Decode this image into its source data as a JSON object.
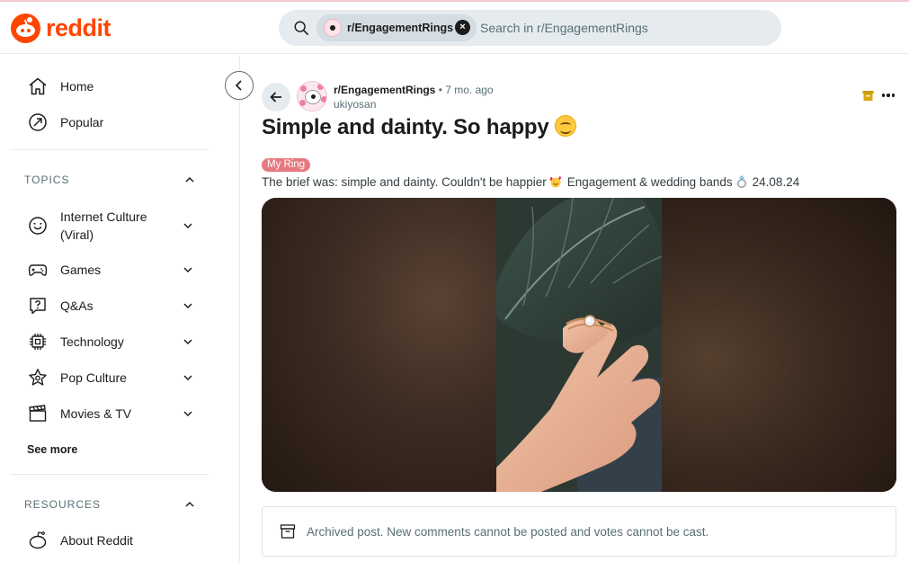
{
  "header": {
    "logo_text": "reddit",
    "search_chip": "r/EngagementRings",
    "search_placeholder": "Search in r/EngagementRings"
  },
  "sidebar": {
    "nav": [
      {
        "label": "Home",
        "icon": "home-icon"
      },
      {
        "label": "Popular",
        "icon": "popular-icon"
      }
    ],
    "topics_heading": "TOPICS",
    "topics": [
      {
        "label": "Internet Culture (Viral)",
        "icon": "smile-icon"
      },
      {
        "label": "Games",
        "icon": "gamepad-icon"
      },
      {
        "label": "Q&As",
        "icon": "question-icon"
      },
      {
        "label": "Technology",
        "icon": "chip-icon"
      },
      {
        "label": "Pop Culture",
        "icon": "star-icon"
      },
      {
        "label": "Movies & TV",
        "icon": "clapper-icon"
      }
    ],
    "see_more": "See more",
    "resources_heading": "RESOURCES",
    "resources": [
      {
        "label": "About Reddit",
        "icon": "about-reddit-icon"
      }
    ]
  },
  "post": {
    "subreddit": "r/EngagementRings",
    "age": "• 7 mo. ago",
    "author": "ukiyosan",
    "title": "Simple and dainty. So happy",
    "flair": "My Ring",
    "body_part1": "The brief was: simple and dainty. Couldn't be happier",
    "body_part2": "Engagement & wedding bands",
    "body_part3": "24.08.24",
    "archived_notice": "Archived post. New comments cannot be posted and votes cannot be cast."
  },
  "colors": {
    "brand": "#ff4500",
    "flair_bg": "#e8787f",
    "search_bg": "#e5ebee",
    "muted_text": "#576f76"
  }
}
